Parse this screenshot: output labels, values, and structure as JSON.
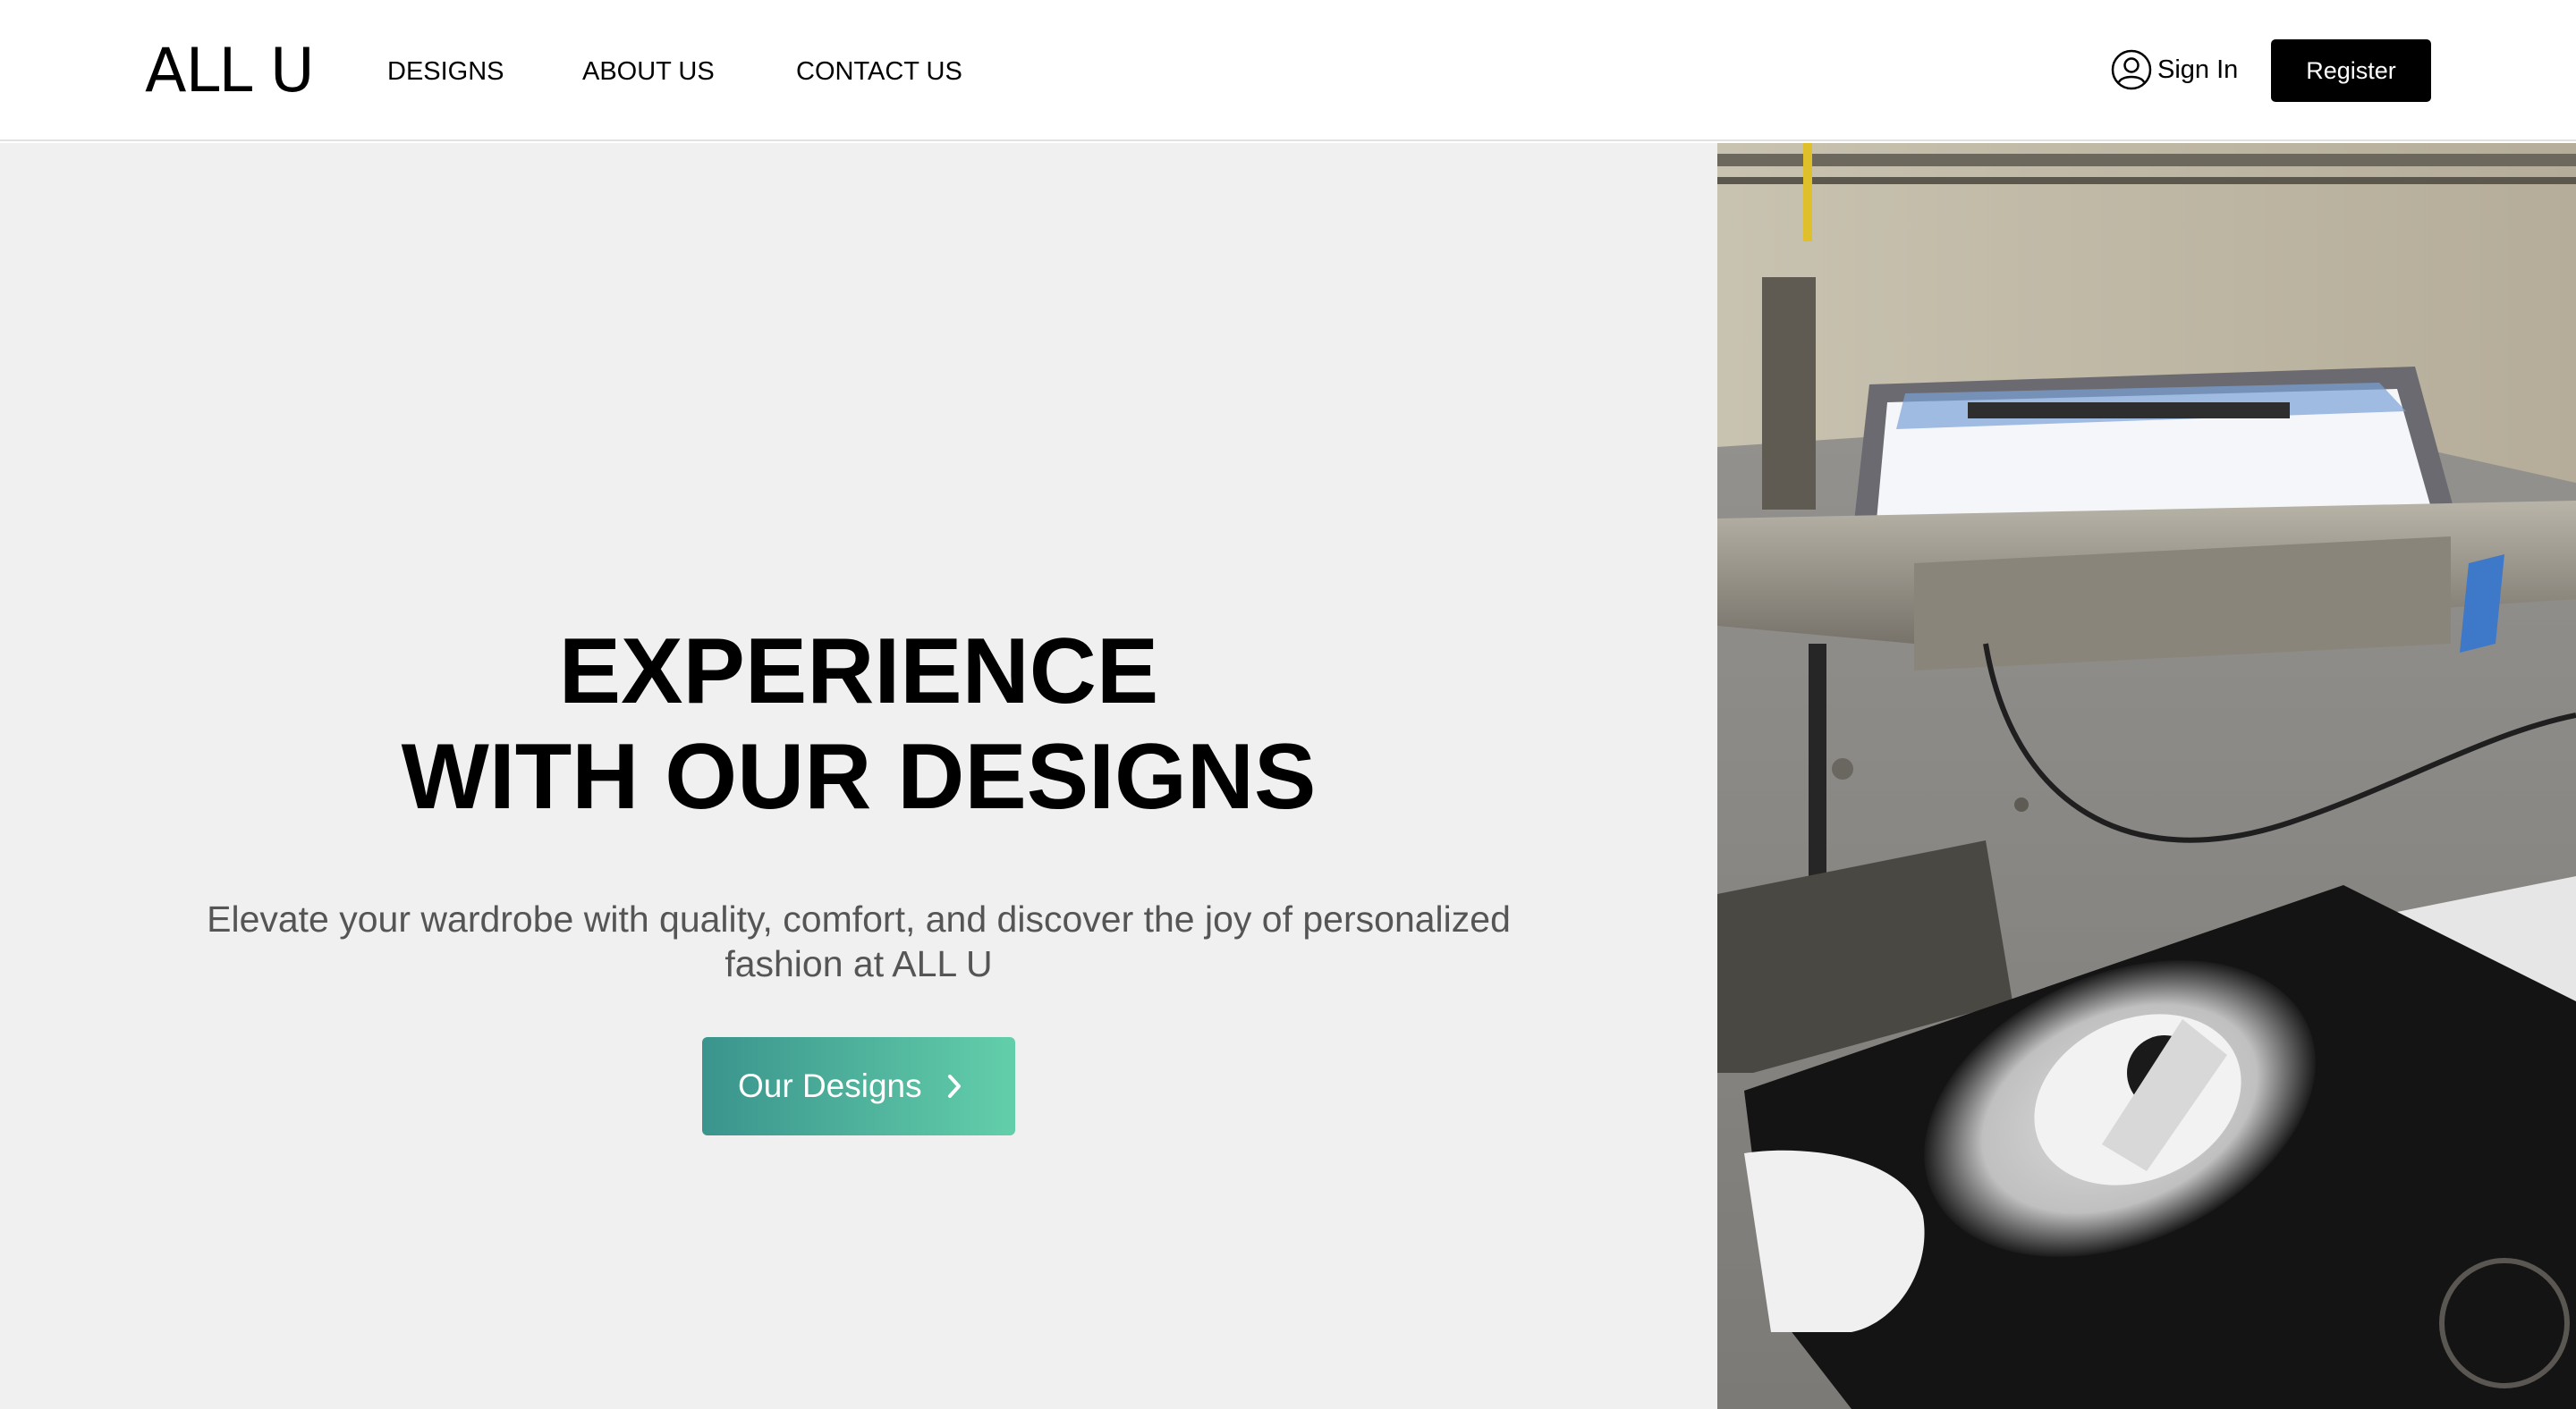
{
  "header": {
    "logo": "ALL U",
    "nav": [
      {
        "label": "DESIGNS"
      },
      {
        "label": "ABOUT US"
      },
      {
        "label": "CONTACT US"
      }
    ],
    "sign_in": {
      "label": "Sign In",
      "icon": "user-circle-icon"
    },
    "register": {
      "label": "Register"
    }
  },
  "hero": {
    "headline_line1": "EXPERIENCE",
    "headline_line2": "WITH OUR DESIGNS",
    "subtext": "Elevate your wardrobe with quality, comfort, and discover the joy of personalized fashion at ALL U",
    "cta": {
      "label": "Our Designs",
      "icon": "chevron-right-icon"
    },
    "image": {
      "subject": "screen-printing-press-photo"
    }
  },
  "colors": {
    "hero_background": "#f0f0f0",
    "cta_gradient_start": "#3a948d",
    "cta_gradient_end": "#63cfaa",
    "register_background": "#000000",
    "text_primary": "#000000",
    "text_secondary": "#555555"
  }
}
